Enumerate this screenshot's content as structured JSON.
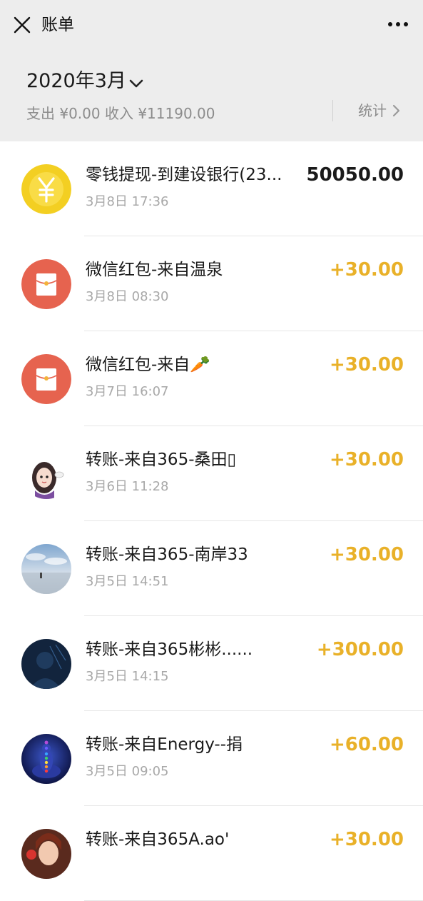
{
  "header": {
    "title": "账单",
    "close_icon": "close-icon",
    "more_icon": "more-icon"
  },
  "month": {
    "title": "2020年3月",
    "summary": "支出 ¥0.00 收入 ¥11190.00",
    "stats_label": "统计"
  },
  "colors": {
    "income": "#e9b129",
    "neutral": "#1a1a1a",
    "coin_yellow": "#f3cf22",
    "redpacket_red": "#e6634f",
    "page_bg": "#ededed"
  },
  "transactions": [
    {
      "title": "零钱提现-到建设银行(23...",
      "time": "3月8日 17:36",
      "amount": "50050.00",
      "type": "neutral",
      "icon": "yuan-coin-icon"
    },
    {
      "title": "微信红包-来自温泉",
      "time": "3月8日 08:30",
      "amount": "+30.00",
      "type": "income",
      "icon": "red-packet-icon"
    },
    {
      "title": "微信红包-来自🥕",
      "time": "3月7日 16:07",
      "amount": "+30.00",
      "type": "income",
      "icon": "red-packet-icon"
    },
    {
      "title": "转账-来自365-桑田▯",
      "time": "3月6日 11:28",
      "amount": "+30.00",
      "type": "income",
      "icon": "cartoon-girl-avatar"
    },
    {
      "title": "转账-来自365-南岸33",
      "time": "3月5日 14:51",
      "amount": "+30.00",
      "type": "income",
      "icon": "beach-photo-avatar"
    },
    {
      "title": "转账-来自365彬彬......",
      "time": "3月5日 14:15",
      "amount": "+300.00",
      "type": "income",
      "icon": "dark-blue-avatar"
    },
    {
      "title": "转账-来自Energy--捐",
      "time": "3月5日 09:05",
      "amount": "+60.00",
      "type": "income",
      "icon": "chakra-meditation-avatar"
    },
    {
      "title": "转账-来自365A.ao'",
      "time": "",
      "amount": "+30.00",
      "type": "income",
      "icon": "portrait-avatar"
    }
  ]
}
